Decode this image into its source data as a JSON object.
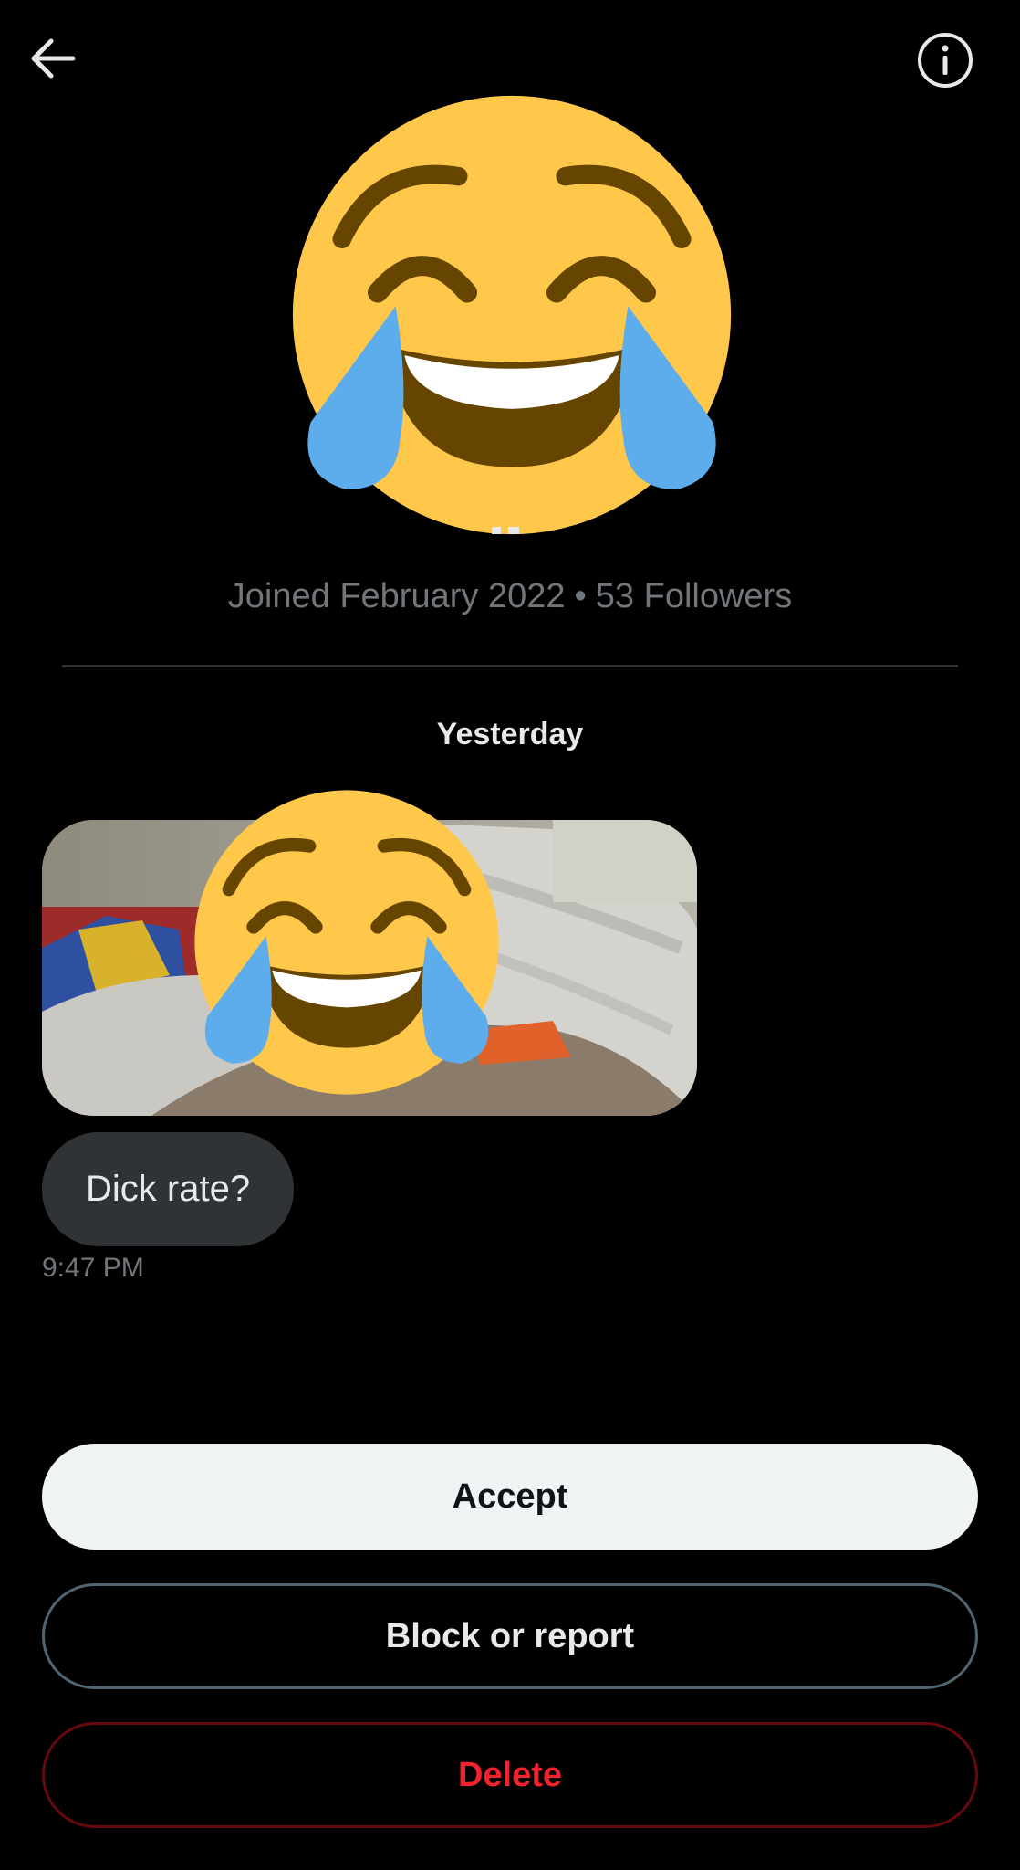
{
  "header": {
    "back_icon": "arrow-left-icon",
    "info_icon": "info-circle-icon"
  },
  "profile": {
    "avatar_icon": "face-with-tears-of-joy-emoji",
    "joined": "Joined February 2022",
    "separator": "•",
    "followers": "53 Followers"
  },
  "conversation": {
    "day_label": "Yesterday",
    "media_overlay_icon": "face-with-tears-of-joy-emoji",
    "message_text": "Dick rate?",
    "timestamp": "9:47 PM"
  },
  "actions": {
    "accept": "Accept",
    "block_or_report": "Block or report",
    "delete": "Delete"
  },
  "colors": {
    "background": "#000000",
    "accept_bg": "#eff3f4",
    "delete_red": "#f4212e",
    "bubble_bg": "#2f3336",
    "muted_text": "#71767b",
    "emoji_yellow": "#ffc84a",
    "emoji_tear": "#5dadec"
  }
}
